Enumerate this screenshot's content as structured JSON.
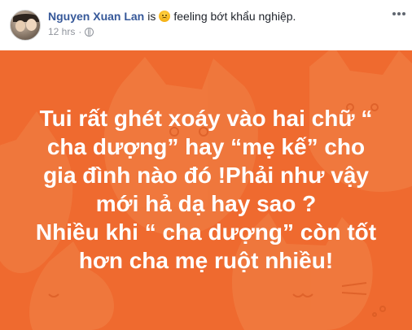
{
  "header": {
    "author_name": "Nguyen Xuan Lan",
    "verb": "is",
    "feeling_text": "feeling bớt khẩu nghiệp.",
    "timestamp": "12 hrs",
    "separator": "·",
    "privacy_icon": "globe-icon",
    "feeling_emoji": "annoyed-face-icon",
    "more_icon": "more-options-icon"
  },
  "post": {
    "background_color": "#ef6a2f",
    "lines": [
      "Tui rất ghét xoáy vào hai chữ “",
      "cha dượng” hay “mẹ kế” cho",
      "gia đình nào đó !Phải như vậy",
      "mới hả dạ hay sao ?",
      "Nhiều khi “ cha dượng” còn tốt",
      "hơn cha mẹ ruột nhiều!"
    ]
  }
}
